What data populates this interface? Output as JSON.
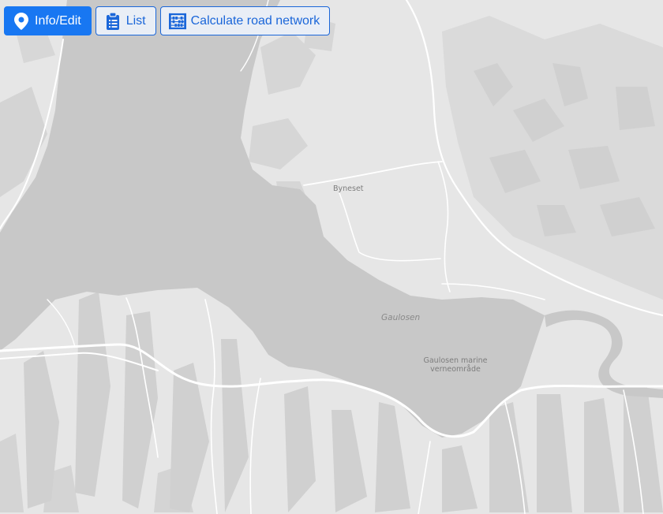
{
  "toolbar": {
    "buttons": [
      {
        "label": "Info/Edit",
        "icon": "map-pin-icon",
        "active": true
      },
      {
        "label": "List",
        "icon": "clipboard-list-icon",
        "active": false
      },
      {
        "label": "Calculate road network",
        "icon": "abacus-icon",
        "active": false
      }
    ]
  },
  "map": {
    "labels": {
      "town": "Byneset",
      "fjord": "Gaulosen",
      "reserve_line1": "Gaulosen marine",
      "reserve_line2": "verneområde"
    }
  },
  "colors": {
    "land": "#e6e6e6",
    "water": "#c8c8c8",
    "terrain": "#cfcfcf",
    "road": "#ffffff",
    "accent": "#1877f2"
  }
}
